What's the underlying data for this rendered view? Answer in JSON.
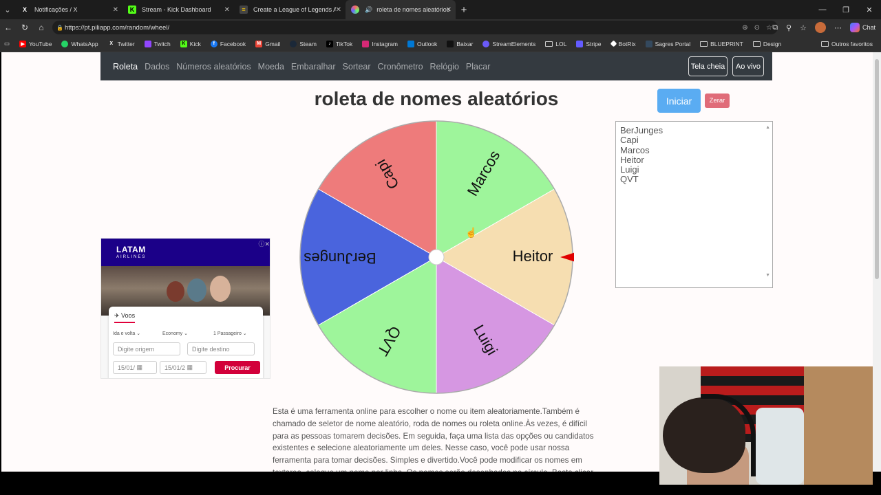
{
  "browser": {
    "tabs": [
      {
        "title": "Notificações / X",
        "icon": "x-icon",
        "active": false
      },
      {
        "title": "Stream - Kick Dashboard",
        "icon": "kick-icon",
        "active": false
      },
      {
        "title": "Create a League of Legends ALWAYS",
        "icon": "doc-icon",
        "active": false
      },
      {
        "title": "roleta de nomes aleatórios",
        "icon": "wheel-icon",
        "active": true
      }
    ],
    "url": "https://pt.piliapp.com/random/wheel/",
    "chat_label": "Chat",
    "bookmarks": [
      "YouTube",
      "WhatsApp",
      "Twitter",
      "Twitch",
      "Kick",
      "Facebook",
      "Gmail",
      "Steam",
      "TikTok",
      "Instagram",
      "Outlook",
      "Baixar",
      "StreamElements",
      "LOL",
      "Stripe",
      "BotRix",
      "Sagres Portal",
      "BLUEPRINT",
      "Design"
    ],
    "bookmarks_other": "Outros favoritos"
  },
  "site": {
    "nav": [
      "Roleta",
      "Dados",
      "Números aleatórios",
      "Moeda",
      "Embaralhar",
      "Sortear",
      "Cronômetro",
      "Relógio",
      "Placar"
    ],
    "fullscreen_label": "Tela cheia",
    "live_label": "Ao vivo",
    "title": "roleta de nomes aleatórios",
    "start_label": "Iniciar",
    "reset_label": "Zerar",
    "names": [
      "BerJunges",
      "Capi",
      "Marcos",
      "Heitor",
      "Luigi",
      "QVT"
    ],
    "description": "Esta é uma ferramenta online para escolher o nome ou item aleatoriamente.Também é chamado de seletor de nome aleatório, roda de nomes ou roleta online.Às vezes, é difícil para as pessoas tomarem decisões. Em seguida, faça uma lista das opções ou candidatos existentes e selecione aleatoriamente um deles. Nesse caso, você pode usar nossa ferramenta para tomar decisões. Simples e divertido.Você pode modificar os nomes em textarea, coloque um nome por linha. Os nomes serão desenhados no círculo. Basta clicar no"
  },
  "wheel": {
    "segments": [
      {
        "label": "BerJunges",
        "color": "#4a64dd"
      },
      {
        "label": "Capi",
        "color": "#ee7b7b"
      },
      {
        "label": "Marcos",
        "color": "#9ef59b"
      },
      {
        "label": "Heitor",
        "color": "#f6deb1"
      },
      {
        "label": "Luigi",
        "color": "#d697e2"
      },
      {
        "label": "QVT",
        "color": "#9ef59b"
      }
    ],
    "pointer_color": "#e00000"
  },
  "ad": {
    "brand": "LATAM",
    "brand_sub": "AIRLINES",
    "tab": "Voos",
    "trip": "Ida e volta",
    "class": "Economy",
    "passengers": "1 Passageiro",
    "origin_placeholder": "Digite origem",
    "dest_placeholder": "Digite destino",
    "date1": "15/01/",
    "date2": "15/01/2",
    "search_label": "Procurar"
  }
}
